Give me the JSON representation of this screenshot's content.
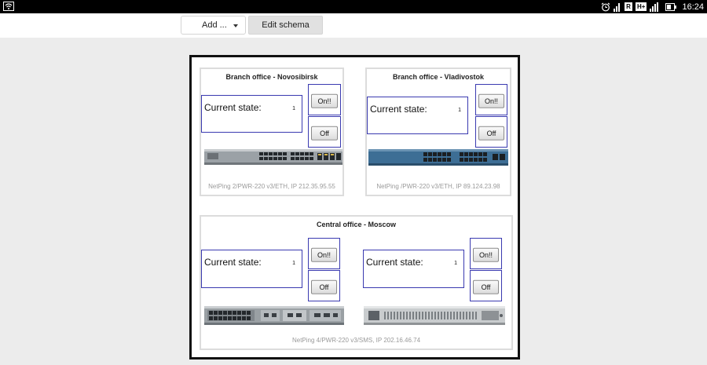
{
  "toolbar": {
    "add_label": "Add ...",
    "edit_label": "Edit schema"
  },
  "statusbar": {
    "time": "16:24",
    "badge_r": "R",
    "badge_h": "H+"
  },
  "schema": {
    "panels": [
      {
        "title": "Branch office - Novosibirsk",
        "caption": "NetPing 2/PWR-220 v3/ETH, IP 212.35.95.55",
        "controls": [
          {
            "state_label": "Current state:",
            "state_value": "1",
            "on_label": "On!!",
            "off_label": "Off"
          }
        ]
      },
      {
        "title": "Branch office - Vladivostok",
        "caption": "NetPing /PWR-220 v3/ETH, IP 89.124.23.98",
        "controls": [
          {
            "state_label": "Current state:",
            "state_value": "1",
            "on_label": "On!!",
            "off_label": "Off"
          }
        ]
      },
      {
        "title": "Central office - Moscow",
        "caption": "NetPing 4/PWR-220 v3/SMS, IP 202.16.46.74",
        "controls": [
          {
            "state_label": "Current state:",
            "state_value": "1",
            "on_label": "On!!",
            "off_label": "Off"
          },
          {
            "state_label": "Current state:",
            "state_value": "1",
            "on_label": "On!!",
            "off_label": "Off"
          }
        ]
      }
    ]
  },
  "colors": {
    "frame_blue": "#3a3ab0",
    "switch_blue": "#3d6e95",
    "switch_gray": "#8e9398"
  }
}
